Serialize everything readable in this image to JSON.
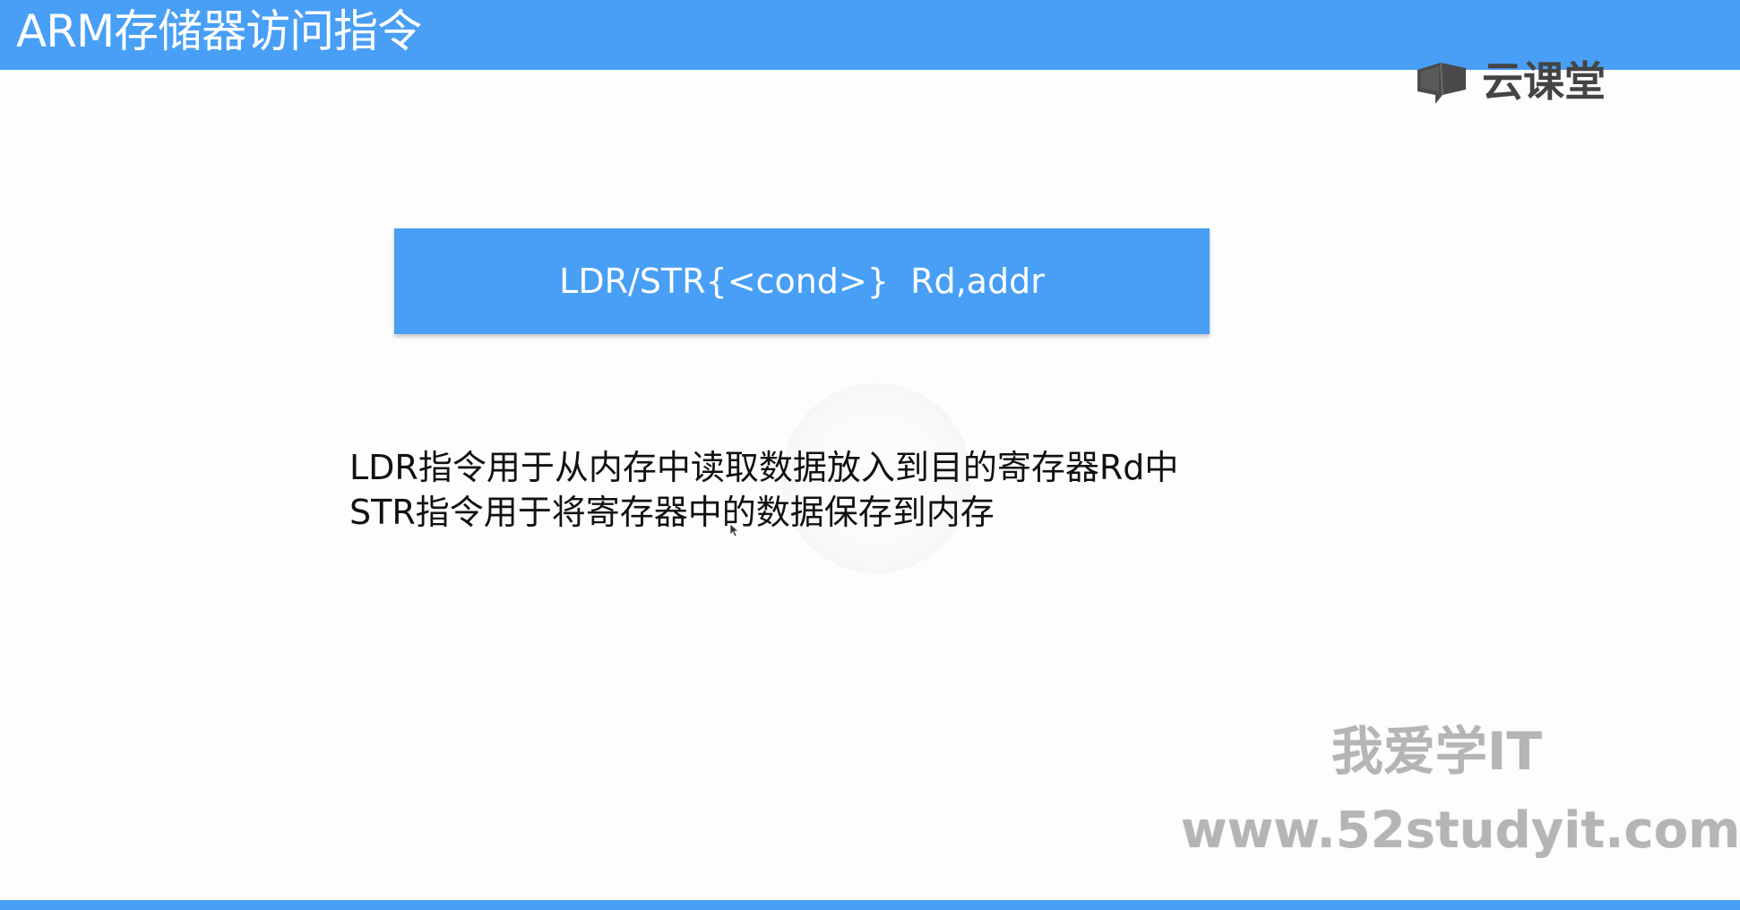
{
  "slide": {
    "title": "ARM存储器访问指令",
    "syntax": "LDR/STR{<cond>}  Rd,addr",
    "description": [
      "LDR指令用于从内存中读取数据放入到目的寄存器Rd中",
      "STR指令用于将寄存器中的数据保存到内存"
    ]
  },
  "brand": {
    "name": "云课堂",
    "icon": "chat-bubble-book-icon"
  },
  "watermark": {
    "name": "我爱学IT",
    "url": "www.52studyit.com"
  },
  "colors": {
    "accent": "#489ff5",
    "background": "#fdfdfd",
    "text": "#111111"
  }
}
